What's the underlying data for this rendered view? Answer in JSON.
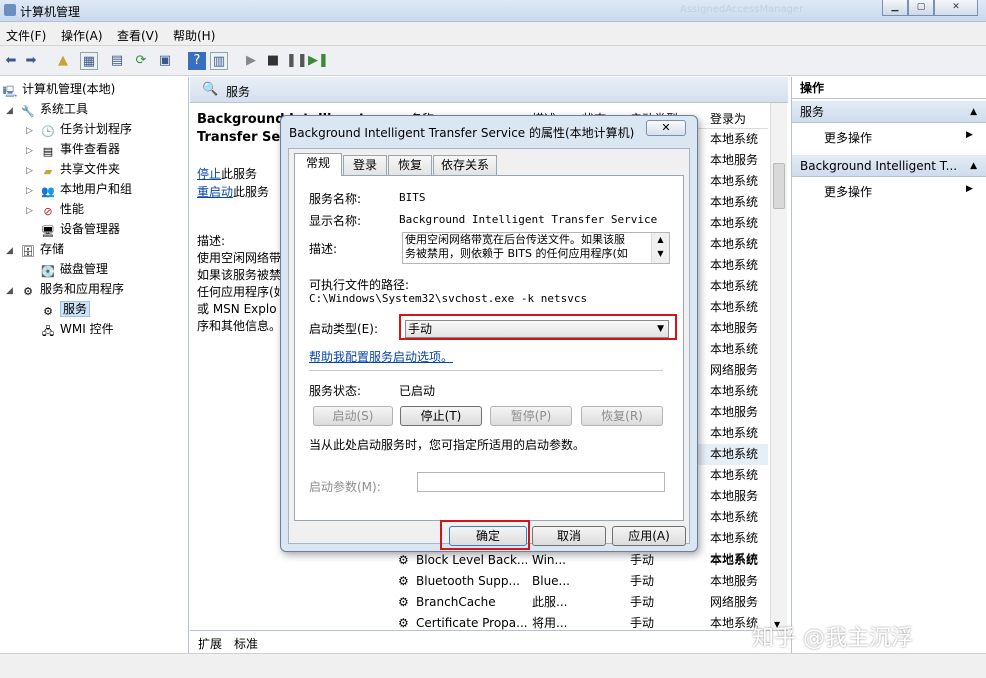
{
  "window": {
    "title": "计算机管理",
    "blurred_tab": "AssignedAccessManager"
  },
  "menu": [
    "文件(F)",
    "操作(A)",
    "查看(V)",
    "帮助(H)"
  ],
  "tree": {
    "root": "计算机管理(本地)",
    "system_tools": "系统工具",
    "task_scheduler": "任务计划程序",
    "event_viewer": "事件查看器",
    "shared_folders": "共享文件夹",
    "local_users": "本地用户和组",
    "performance": "性能",
    "device_manager": "设备管理器",
    "storage": "存储",
    "disk_mgmt": "磁盘管理",
    "svc_apps": "服务和应用程序",
    "services": "服务",
    "wmi": "WMI 控件"
  },
  "center": {
    "header": "服务",
    "service_name": "Background Intelligent Transfer Service",
    "stop_link": "停止",
    "stop_suffix": "此服务",
    "restart_link": "重启动",
    "restart_suffix": "此服务",
    "desc_label": "描述:",
    "desc_lines": [
      "使用空闲网络带",
      "如果该服务被禁",
      "任何应用程序(如",
      "或 MSN Explo",
      "序和其他信息。"
    ],
    "columns": {
      "name": "名称",
      "desc": "描述",
      "status": "状态",
      "startup": "启动类型",
      "logon": "登录为"
    },
    "logon_column": [
      "本地系统",
      "本地服务",
      "本地系统",
      "本地系统",
      "本地系统",
      "本地系统",
      "本地系统",
      "本地系统",
      "本地系统",
      "本地服务",
      "本地系统",
      "网络服务",
      "本地系统",
      "本地服务",
      "本地系统",
      "本地系统",
      "本地系统",
      "本地服务",
      "本地系统",
      "本地系统",
      "本地系统"
    ],
    "visible_rows": [
      {
        "name": "Block Level Back...",
        "desc": "Win...",
        "startup": "手动",
        "logon": "本地系统"
      },
      {
        "name": "Bluetooth Supp...",
        "desc": "Blue...",
        "startup": "手动",
        "logon": "本地服务"
      },
      {
        "name": "BranchCache",
        "desc": "此服...",
        "startup": "手动",
        "logon": "网络服务"
      },
      {
        "name": "Certificate Propa...",
        "desc": "将用...",
        "startup": "手动",
        "logon": "本地系统"
      }
    ],
    "tabs": [
      "扩展",
      "标准"
    ]
  },
  "actions": {
    "title": "操作",
    "group1": "服务",
    "more1": "更多操作",
    "group2": "Background Intelligent T...",
    "more2": "更多操作"
  },
  "dialog": {
    "title": "Background Intelligent Transfer Service 的属性(本地计算机)",
    "close": "✕",
    "tabs": [
      "常规",
      "登录",
      "恢复",
      "依存关系"
    ],
    "service_name_label": "服务名称:",
    "service_name": "BITS",
    "display_name_label": "显示名称:",
    "display_name": "Background Intelligent Transfer Service",
    "desc_label": "描述:",
    "desc_line1": "使用空闲网络带宽在后台传送文件。如果该服",
    "desc_line2": "务被禁用，则依赖于 BITS 的任何应用程序(如",
    "exe_label": "可执行文件的路径:",
    "exe_path": "C:\\Windows\\System32\\svchost.exe -k netsvcs",
    "startup_type_label": "启动类型(E):",
    "startup_type": "手动",
    "help_link": "帮助我配置服务启动选项。",
    "status_label": "服务状态:",
    "status": "已启动",
    "btn_start": "启动(S)",
    "btn_stop": "停止(T)",
    "btn_pause": "暂停(P)",
    "btn_resume": "恢复(R)",
    "hint": "当从此处启动服务时，您可指定所适用的启动参数。",
    "param_label": "启动参数(M):",
    "ok": "确定",
    "cancel": "取消",
    "apply": "应用(A)"
  },
  "watermark": "知乎 @我主沉浮"
}
